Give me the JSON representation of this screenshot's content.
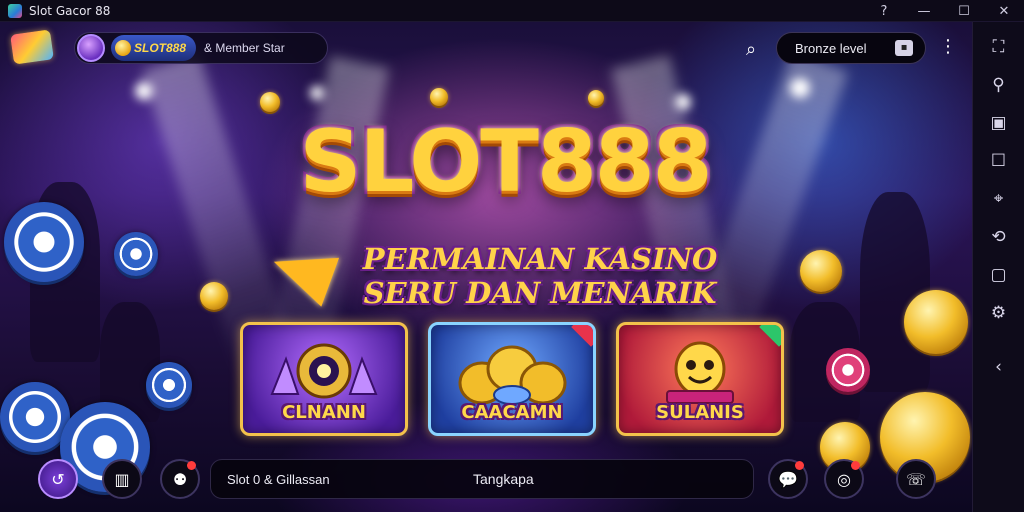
{
  "window": {
    "title": "Slot Gacor 88",
    "controls": {
      "help": "?",
      "minimize": "—",
      "maximize": "☐",
      "close": "✕"
    }
  },
  "header": {
    "logo_icon": "game-logo",
    "brand": "SLOT888",
    "member_label": "& Member Star",
    "search_icon": "search-icon",
    "field_text": "Bronze level",
    "field_icon": "wallet-icon",
    "menu_icon": "⋮"
  },
  "hero": {
    "title": "SLOT888",
    "tagline_line1": "PERMAINAN KASINO",
    "tagline_line2": "SERU DAN MENARIK"
  },
  "cards": [
    {
      "label": "CLNANN",
      "icon": "slot-machine-icon",
      "accent": "#b36cff"
    },
    {
      "label": "CAACAMN",
      "icon": "coins-icon",
      "accent": "#6fa8ff"
    },
    {
      "label": "SULANIS",
      "icon": "mascot-icon",
      "accent": "#ff7a5a"
    }
  ],
  "bottom_bar": {
    "left_text": "Slot 0 & Gillassan",
    "right_text": "Tangkapa"
  },
  "bottom_buttons_left": [
    {
      "icon": "refresh-icon",
      "glyph": "↺"
    },
    {
      "icon": "leaderboard-icon",
      "glyph": "▥"
    },
    {
      "icon": "profile-icon",
      "glyph": "⚉"
    }
  ],
  "bottom_buttons_right": [
    {
      "icon": "chat-icon",
      "glyph": "💬"
    },
    {
      "icon": "target-icon",
      "glyph": "◎"
    },
    {
      "icon": "support-icon",
      "glyph": "☏"
    }
  ],
  "side_toolbar": [
    {
      "icon": "fullscreen-icon",
      "glyph": "⛶"
    },
    {
      "icon": "pin-icon",
      "glyph": "⚲"
    },
    {
      "icon": "screenshot-icon",
      "glyph": "▣"
    },
    {
      "icon": "window-icon",
      "glyph": "☐"
    },
    {
      "icon": "location-icon",
      "glyph": "⌖"
    },
    {
      "icon": "rotate-icon",
      "glyph": "⟲"
    },
    {
      "icon": "record-icon",
      "glyph": "▢"
    },
    {
      "icon": "settings-icon",
      "glyph": "⚙"
    },
    {
      "icon": "back-icon",
      "glyph": "‹"
    }
  ],
  "colors": {
    "accent_gold": "#ffd23e",
    "accent_purple": "#7a1f8e",
    "background": "#1a0f3a"
  }
}
